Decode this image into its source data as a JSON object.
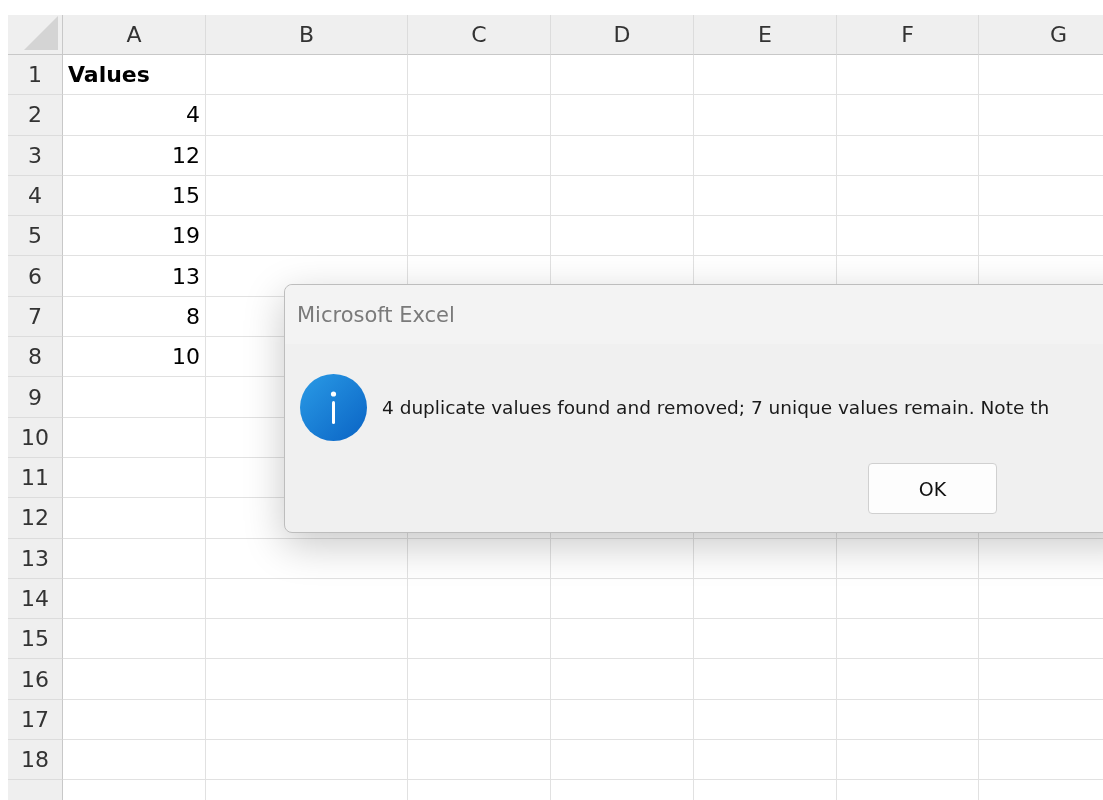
{
  "sheet": {
    "columns": [
      "A",
      "B",
      "C",
      "D",
      "E",
      "F",
      "G"
    ],
    "rows": [
      {
        "number": "1",
        "cells": [
          {
            "text": "Values",
            "bold": true
          }
        ]
      },
      {
        "number": "2",
        "cells": [
          {
            "text": "4",
            "bold": false
          }
        ]
      },
      {
        "number": "3",
        "cells": [
          {
            "text": "12",
            "bold": false
          }
        ]
      },
      {
        "number": "4",
        "cells": [
          {
            "text": "15",
            "bold": false
          }
        ]
      },
      {
        "number": "5",
        "cells": [
          {
            "text": "19",
            "bold": false
          }
        ]
      },
      {
        "number": "6",
        "cells": [
          {
            "text": "13",
            "bold": false
          }
        ]
      },
      {
        "number": "7",
        "cells": [
          {
            "text": "8",
            "bold": false
          }
        ]
      },
      {
        "number": "8",
        "cells": [
          {
            "text": "10",
            "bold": false
          }
        ]
      },
      {
        "number": "9",
        "cells": []
      },
      {
        "number": "10",
        "cells": []
      },
      {
        "number": "11",
        "cells": []
      },
      {
        "number": "12",
        "cells": []
      },
      {
        "number": "13",
        "cells": []
      },
      {
        "number": "14",
        "cells": []
      },
      {
        "number": "15",
        "cells": []
      },
      {
        "number": "16",
        "cells": []
      },
      {
        "number": "17",
        "cells": []
      },
      {
        "number": "18",
        "cells": []
      }
    ]
  },
  "dialog": {
    "title": "Microsoft Excel",
    "message": "4 duplicate values found and removed; 7 unique values remain. Note th",
    "buttons": [
      "OK"
    ]
  }
}
